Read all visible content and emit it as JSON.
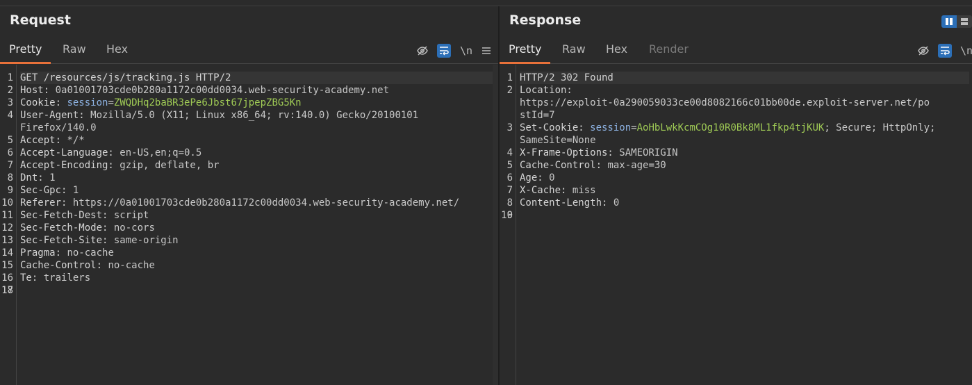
{
  "request": {
    "title": "Request",
    "tabs": [
      "Pretty",
      "Raw",
      "Hex"
    ],
    "tools": {
      "newline_label": "\\n"
    },
    "lines": [
      {
        "n": "1",
        "text": "GET /resources/js/tracking.js HTTP/2"
      },
      {
        "n": "2",
        "k": "Host:",
        "v": " 0a01001703cde0b280a1172c00dd0034.web-security-academy.net"
      },
      {
        "n": "3",
        "k": "Cookie:",
        "ck": " session",
        "eq": "=",
        "cv": "ZWQDHq2baBR3ePe6Jbst67jpepZBG5Kn"
      },
      {
        "n": "4",
        "k": "User-Agent:",
        "v": " Mozilla/5.0 (X11; Linux x86_64; rv:140.0) Gecko/20100101"
      },
      {
        "n": "",
        "v": "Firefox/140.0"
      },
      {
        "n": "5",
        "k": "Accept:",
        "v": " */*"
      },
      {
        "n": "6",
        "k": "Accept-Language:",
        "v": " en-US,en;q=0.5"
      },
      {
        "n": "7",
        "k": "Accept-Encoding:",
        "v": " gzip, deflate, br"
      },
      {
        "n": "8",
        "k": "Dnt:",
        "v": " 1"
      },
      {
        "n": "9",
        "k": "Sec-Gpc:",
        "v": " 1"
      },
      {
        "n": "10",
        "k": "Referer:",
        "v": " https://0a01001703cde0b280a1172c00dd0034.web-security-academy.net/"
      },
      {
        "n": "11",
        "k": "Sec-Fetch-Dest:",
        "v": " script"
      },
      {
        "n": "12",
        "k": "Sec-Fetch-Mode:",
        "v": " no-cors"
      },
      {
        "n": "13",
        "k": "Sec-Fetch-Site:",
        "v": " same-origin"
      },
      {
        "n": "14",
        "k": "Pragma:",
        "v": " no-cache"
      },
      {
        "n": "15",
        "k": "Cache-Control:",
        "v": " no-cache"
      },
      {
        "n": "16",
        "k": "Te:",
        "v": " trailers"
      },
      {
        "n": "17",
        "text": ""
      },
      {
        "n": "18",
        "text": ""
      }
    ]
  },
  "response": {
    "title": "Response",
    "tabs": [
      "Pretty",
      "Raw",
      "Hex",
      "Render"
    ],
    "tools": {
      "newline_label": "\\n"
    },
    "lines": [
      {
        "n": "1",
        "text": "HTTP/2 302 Found"
      },
      {
        "n": "2",
        "k": "Location:",
        "v": ""
      },
      {
        "n": "",
        "v": "https://exploit-0a290059033ce00d8082166c01bb00de.exploit-server.net/po"
      },
      {
        "n": "",
        "v": "stId=7"
      },
      {
        "n": "3",
        "k": "Set-Cookie:",
        "ck": " session",
        "eq": "=",
        "cv": "AoHbLwkKcmCOg10R0Bk8ML1fkp4tjKUK",
        "tail": "; Secure; HttpOnly;"
      },
      {
        "n": "",
        "v": "SameSite=None"
      },
      {
        "n": "4",
        "k": "X-Frame-Options:",
        "v": " SAMEORIGIN"
      },
      {
        "n": "5",
        "k": "Cache-Control:",
        "v": " max-age=30"
      },
      {
        "n": "6",
        "k": "Age:",
        "v": " 0"
      },
      {
        "n": "7",
        "k": "X-Cache:",
        "v": " miss"
      },
      {
        "n": "8",
        "k": "Content-Length:",
        "v": " 0"
      },
      {
        "n": "9",
        "text": ""
      },
      {
        "n": "10",
        "text": ""
      }
    ]
  }
}
